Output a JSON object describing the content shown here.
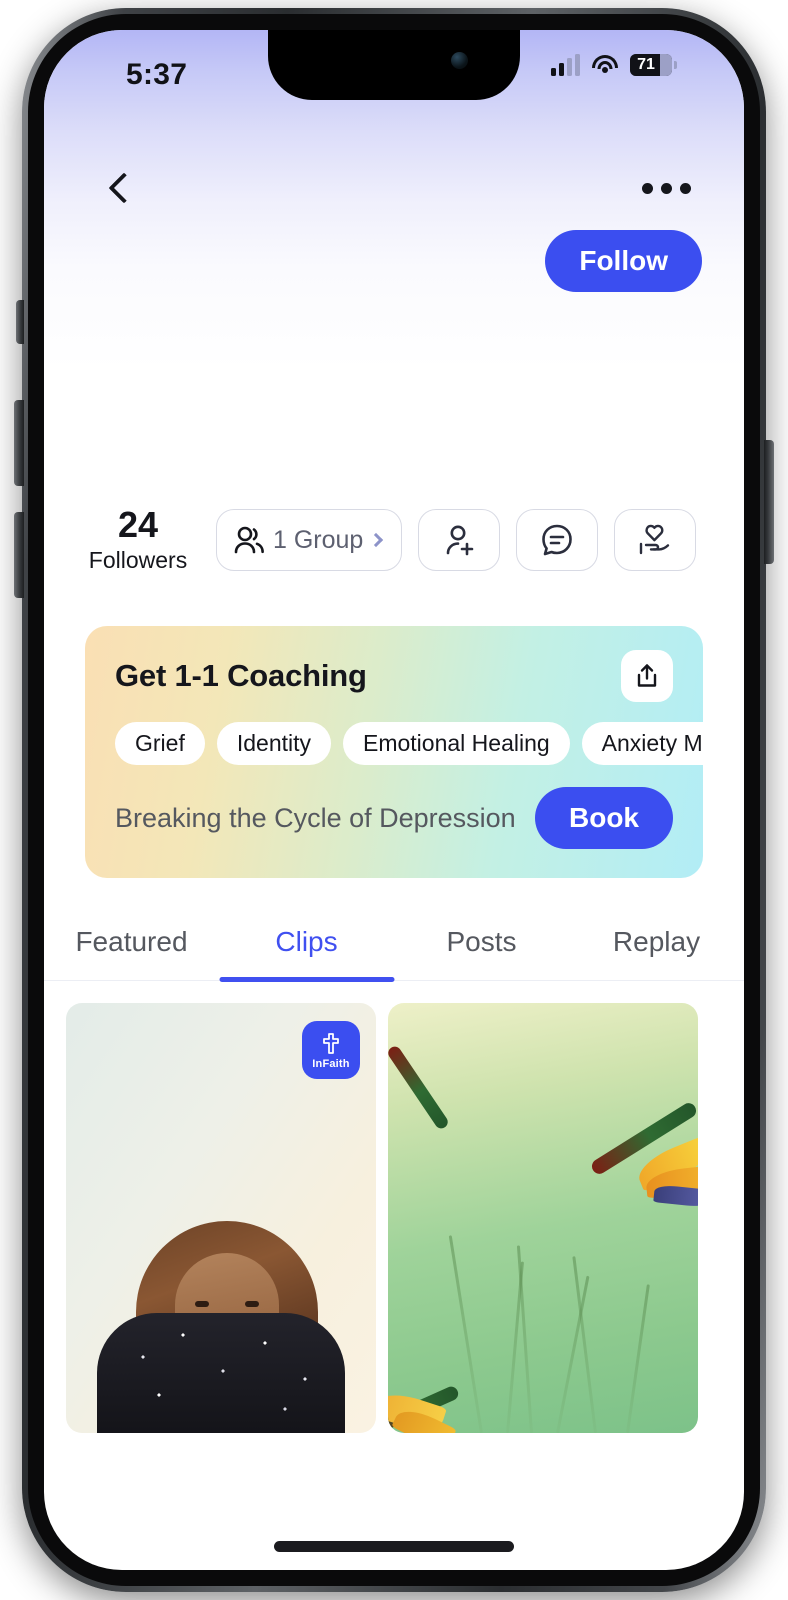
{
  "status_bar": {
    "time": "5:37",
    "battery_percent": "71",
    "signal_icon": "cellular-signal-icon",
    "wifi_icon": "wifi-icon",
    "battery_icon": "battery-icon"
  },
  "nav": {
    "back_icon": "chevron-left-icon",
    "more_icon": "more-options-icon"
  },
  "profile": {
    "follow_label": "Follow",
    "followers_count": "24",
    "followers_label": "Followers",
    "group_label": "1 Group",
    "group_icon": "people-group-icon",
    "group_chevron_icon": "chevron-right-icon",
    "actions": [
      {
        "name": "add-person-button",
        "icon": "person-add-icon"
      },
      {
        "name": "message-button",
        "icon": "message-bubble-icon"
      },
      {
        "name": "prayer-button",
        "icon": "hand-heart-icon"
      }
    ]
  },
  "coaching_card": {
    "title": "Get 1-1 Coaching",
    "share_icon": "share-icon",
    "tags": [
      "Grief",
      "Identity",
      "Emotional Healing",
      "Anxiety Management"
    ],
    "session_label": "Breaking the Cycle of Depression",
    "book_label": "Book"
  },
  "tabs": [
    {
      "label": "Featured",
      "active": false
    },
    {
      "label": "Clips",
      "active": true
    },
    {
      "label": "Posts",
      "active": false
    },
    {
      "label": "Replay",
      "active": false
    }
  ],
  "clips": [
    {
      "name": "clip-thumbnail-portrait",
      "badge": "InFaith",
      "badge_icon": "cross-icon"
    },
    {
      "name": "clip-thumbnail-flowers",
      "badge": "",
      "badge_icon": ""
    }
  ],
  "colors": {
    "accent": "#3B4EF0",
    "tab_active": "#4050F0",
    "text_primary": "#15161C",
    "text_secondary": "#55585F",
    "card_gradient_start": "#FADFB4",
    "card_gradient_end": "#B2EDF6",
    "header_gradient_start": "#B3B6F5"
  }
}
